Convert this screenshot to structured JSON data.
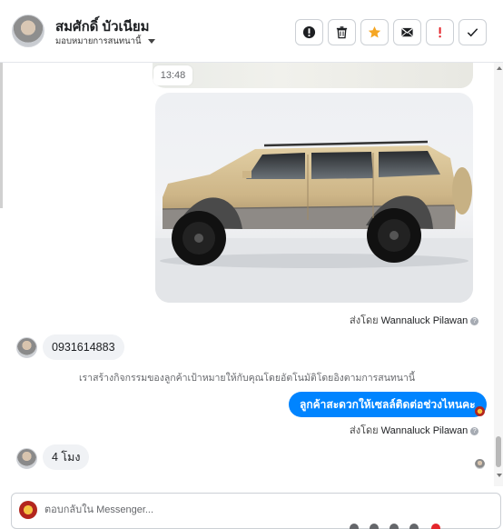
{
  "header": {
    "name": "สมศักดิ์ บัวเนียม",
    "assign_label": "มอบหมายการสนทนานี้",
    "tools": [
      {
        "name": "mark-spam-button",
        "icon": "alert-circle-icon"
      },
      {
        "name": "delete-button",
        "icon": "trash-icon"
      },
      {
        "name": "star-button",
        "icon": "star-icon"
      },
      {
        "name": "mark-unread-button",
        "icon": "envelope-icon"
      },
      {
        "name": "follow-up-button",
        "icon": "exclamation-icon"
      },
      {
        "name": "mark-done-button",
        "icon": "check-icon"
      }
    ]
  },
  "thread": {
    "prev_time": "13:48",
    "photo_sent_by_prefix": "ส่งโดย",
    "photo_sent_by_name": "Wannaluck Pilawan",
    "msg_phone": "0931614883",
    "system_note": "เราสร้างกิจกรรมของลูกค้าเป้าหมายให้กับคุณโดยอัตโนมัติโดยอิงตามการสนทนานี้",
    "msg_out": "ลูกค้าสะดวกให้เซลล์ติดต่อช่วงไหนคะ",
    "out_sent_by_prefix": "ส่งโดย",
    "out_sent_by_name": "Wannaluck Pilawan",
    "msg_reply": "4 โมง"
  },
  "composer": {
    "placeholder": "ตอบกลับใน Messenger..."
  },
  "colors": {
    "accent_blue": "#0084ff",
    "star_orange": "#f5a623",
    "alert_red": "#e4262c"
  }
}
